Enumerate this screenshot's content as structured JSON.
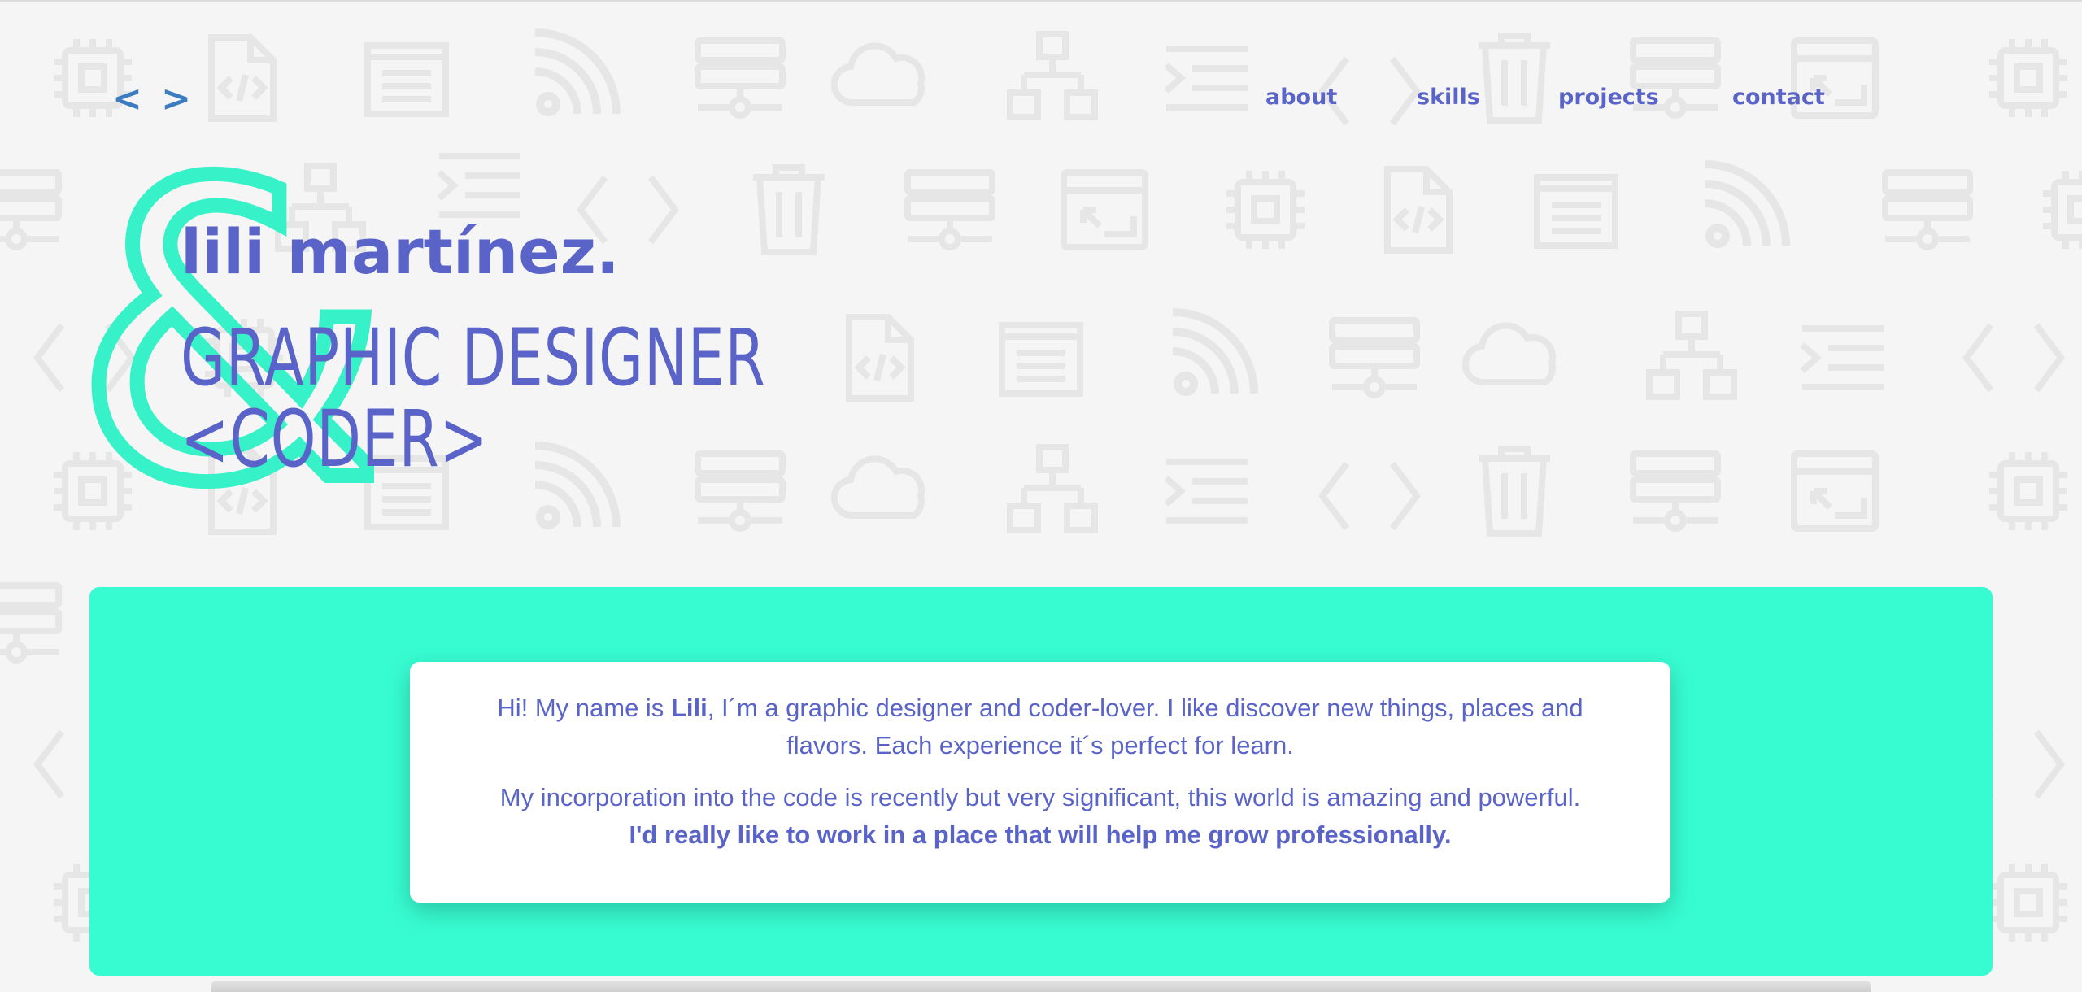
{
  "logo": "< >",
  "nav": {
    "items": [
      {
        "label": "about"
      },
      {
        "label": "skills"
      },
      {
        "label": "projects"
      },
      {
        "label": "contact"
      }
    ]
  },
  "hero": {
    "name": "lili martínez.",
    "ampersand": "&",
    "role_line1": "GRAPHIC DESIGNER",
    "role_line2": "<CODER>"
  },
  "about": {
    "p1_before": "Hi! My name is ",
    "p1_name": "Lili",
    "p1_after": ", I´m a graphic designer and coder-lover. I like discover new things, places and flavors. Each experience it´s perfect for learn.",
    "p2_before": "My incorporation into the code is recently but very significant, this world is amazing and powerful. ",
    "p2_bold": "I'd really like to work in a place that will help me grow professionally."
  },
  "colors": {
    "background": "#f5f5f5",
    "accent_text": "#5a64c8",
    "logo": "#3c7cc0",
    "teal": "#37fcd2",
    "card": "#ffffff",
    "pattern_icons": "#e9e9e9"
  },
  "background_icons": [
    "chip-icon",
    "code-file-icon",
    "folder-icon",
    "rss-icon",
    "server-icon",
    "cloud-icon",
    "sitemap-icon",
    "list-indent-icon",
    "angle-brackets-icon",
    "trash-icon",
    "window-icon"
  ]
}
